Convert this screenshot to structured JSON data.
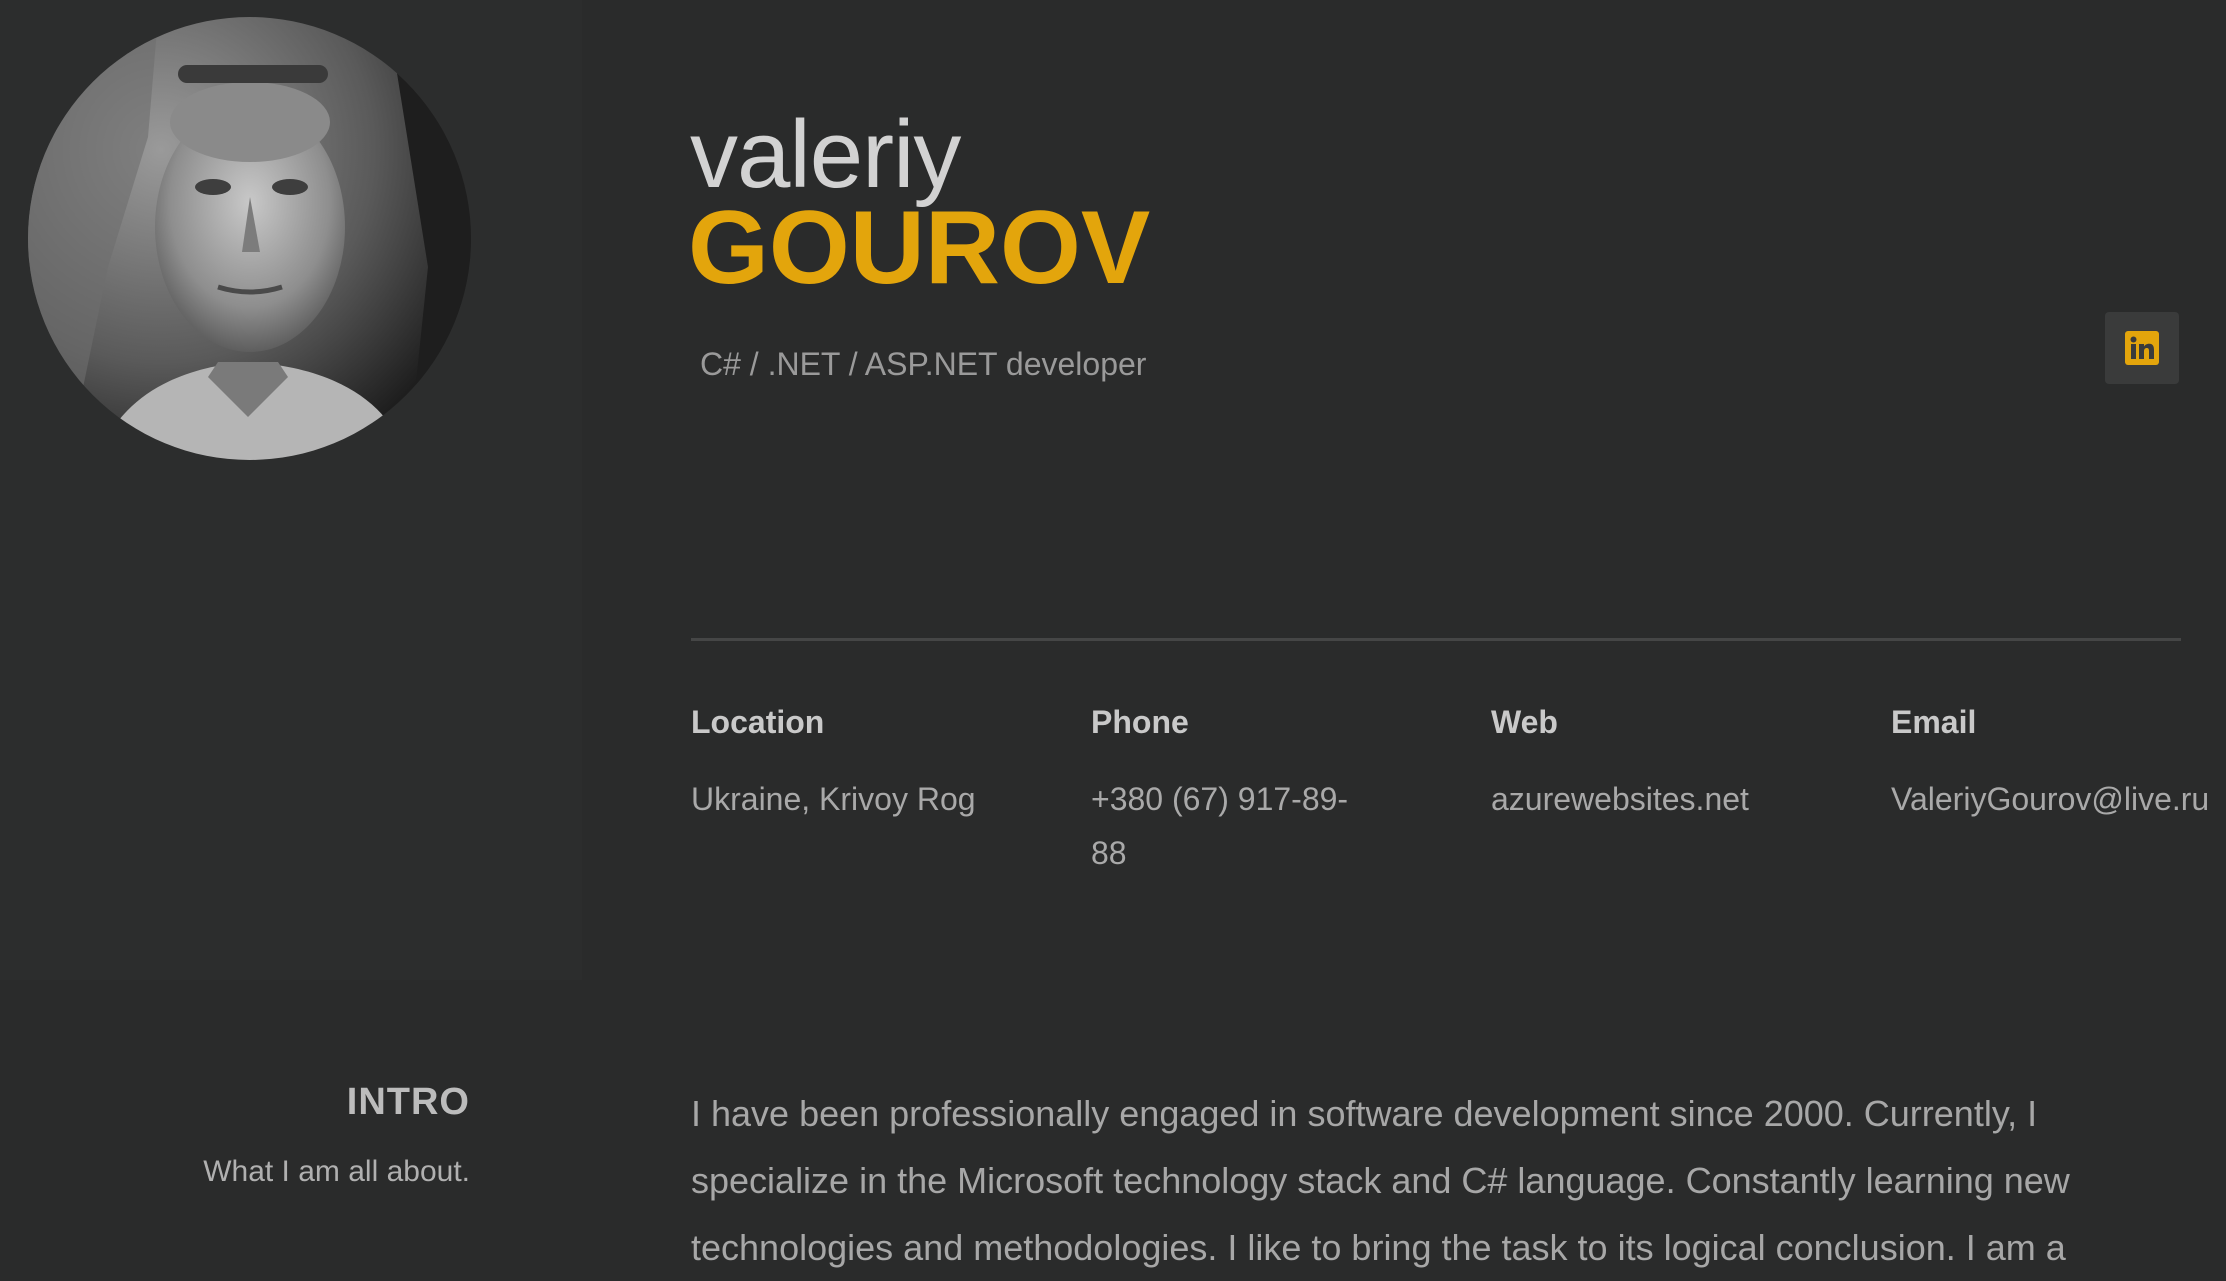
{
  "profile": {
    "first_name": "valeriy",
    "last_name": "GOUROV",
    "subtitle": "C# / .NET / ASP.NET developer",
    "avatar_alt": "photo"
  },
  "social": {
    "linkedin_icon": "linkedin-icon",
    "linkedin_glyph": "in"
  },
  "contacts": {
    "location": {
      "label": "Location",
      "value": "Ukraine, Krivoy Rog"
    },
    "phone": {
      "label": "Phone",
      "value": "+380 (67) 917-89-88"
    },
    "web": {
      "label": "Web",
      "value": "azurewebsites.net"
    },
    "email": {
      "label": "Email",
      "value": "ValeriyGourov@live.ru"
    }
  },
  "intro": {
    "title": "INTRO",
    "subtitle": "What I am all about.",
    "text": "I have been professionally engaged in software development since 2000. Currently, I specialize in the Microsoft technology stack and C# language. Constantly learning new technologies and methodologies. I like to bring the task to its logical conclusion. I am a"
  },
  "colors": {
    "background": "#2a2b2b",
    "accent": "#e3a50c",
    "text": "#a9a9a9"
  }
}
